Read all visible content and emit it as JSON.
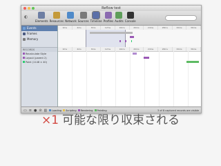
{
  "window": {
    "title": "Reflow test"
  },
  "toolbar": {
    "items": [
      {
        "label": "Elements",
        "color": "#6d7ea3"
      },
      {
        "label": "Resources",
        "color": "#c49a3a"
      },
      {
        "label": "Network",
        "color": "#4f8ac9"
      },
      {
        "label": "Sources",
        "color": "#7a7a7a"
      },
      {
        "label": "Timeline",
        "color": "#5a6fa8",
        "selected": true
      },
      {
        "label": "Profiles",
        "color": "#8b6bb0"
      },
      {
        "label": "Audits",
        "color": "#5e9e5a"
      },
      {
        "label": "Console",
        "color": "#333333"
      }
    ]
  },
  "sidebar": {
    "categories": [
      {
        "label": "Events",
        "selected": true,
        "color": "#6fa0d8"
      },
      {
        "label": "Frames",
        "color": "#4a5a80"
      },
      {
        "label": "Memory",
        "color": "#7a7a7a"
      }
    ],
    "records_header": "RECORDS",
    "records": [
      {
        "label": "Recalculate Style",
        "color": "#9b59b6"
      },
      {
        "label": "Layout (parent 2)",
        "color": "#9b59b6"
      },
      {
        "label": "Paint (1148 × 40)",
        "color": "#2ecc71"
      }
    ]
  },
  "timeline": {
    "ticks": [
      "0ms",
      "4ms",
      "8ms",
      "12ms",
      "16ms",
      "20ms",
      "24ms",
      "28ms",
      "32ms",
      "36ms"
    ],
    "ticks2": [
      "0ms",
      "4ms",
      "8ms",
      "12ms",
      "16ms",
      "20ms",
      "24ms",
      "28ms",
      "32ms",
      "36ms"
    ],
    "overview_bars": [
      {
        "start": 0.22,
        "end": 0.52,
        "row": 0,
        "color": "#b8b8b8"
      },
      {
        "start": 0.5,
        "end": 0.53,
        "row": 1,
        "color": "#9b59b6"
      },
      {
        "start": 0.43,
        "end": 0.44,
        "row": 2,
        "color": "#9b59b6"
      },
      {
        "start": 0.47,
        "end": 0.48,
        "row": 2,
        "color": "#9b59b6"
      },
      {
        "start": 0.51,
        "end": 0.515,
        "row": 2,
        "color": "#2ecc71"
      }
    ],
    "record_bars": [
      {
        "row": 0,
        "start": 0.52,
        "end": 0.55,
        "color": "#b18bd0"
      },
      {
        "row": 1,
        "start": 0.6,
        "end": 0.64,
        "color": "#9b59b6"
      },
      {
        "row": 2,
        "start": 0.9,
        "end": 0.985,
        "color": "#5dbb63"
      }
    ]
  },
  "statusbar": {
    "legend": [
      {
        "label": "Loading",
        "color": "#4f8ac9"
      },
      {
        "label": "Scripting",
        "color": "#e6c14a"
      },
      {
        "label": "Rendering",
        "color": "#9b59b6"
      },
      {
        "label": "Painting",
        "color": "#5dbb63"
      }
    ],
    "count_text": "3 of 8 captured records are visible"
  },
  "caption": {
    "multiplier": "×1",
    "text": "可能な限り収束される"
  }
}
